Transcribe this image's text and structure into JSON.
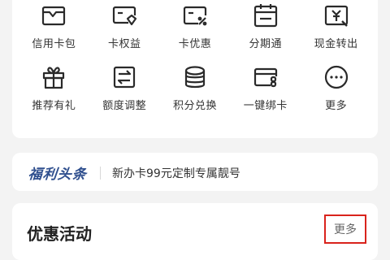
{
  "grid": {
    "items": [
      {
        "label": "信用卡包",
        "icon": "card-wallet-icon"
      },
      {
        "label": "卡权益",
        "icon": "card-benefits-icon"
      },
      {
        "label": "卡优惠",
        "icon": "card-discount-icon"
      },
      {
        "label": "分期通",
        "icon": "calendar-installment-icon"
      },
      {
        "label": "现金转出",
        "icon": "cash-transfer-icon"
      },
      {
        "label": "推荐有礼",
        "icon": "gift-icon"
      },
      {
        "label": "额度调整",
        "icon": "limit-adjust-icon"
      },
      {
        "label": "积分兑换",
        "icon": "points-coins-icon"
      },
      {
        "label": "一键绑卡",
        "icon": "bind-card-icon"
      },
      {
        "label": "更多",
        "icon": "more-dots-icon"
      }
    ]
  },
  "news": {
    "brand": "福利头条",
    "headline": "新办卡99元定制专属靓号"
  },
  "promo": {
    "title": "优惠活动",
    "more_label": "更多"
  },
  "colors": {
    "brand": "#2f4f8e",
    "highlight": "#d9231c"
  }
}
